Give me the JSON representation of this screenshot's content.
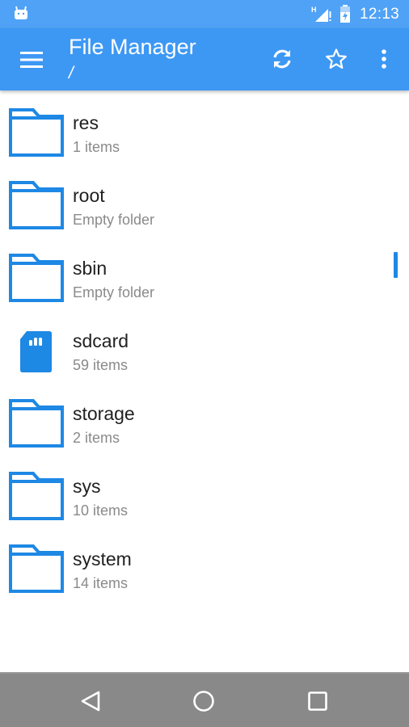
{
  "status_bar": {
    "time": "12:13",
    "network_label": "H",
    "icons": [
      "android-notification-icon",
      "signal-icon",
      "battery-charging-icon"
    ]
  },
  "app_bar": {
    "title": "File Manager",
    "path": "/",
    "icons": [
      "menu-icon",
      "refresh-icon",
      "star-icon",
      "more-vert-icon"
    ]
  },
  "files": [
    {
      "name": "res",
      "meta": "1 items",
      "icon": "folder-icon"
    },
    {
      "name": "root",
      "meta": "Empty folder",
      "icon": "folder-icon"
    },
    {
      "name": "sbin",
      "meta": "Empty folder",
      "icon": "folder-icon"
    },
    {
      "name": "sdcard",
      "meta": "59 items",
      "icon": "sdcard-icon"
    },
    {
      "name": "storage",
      "meta": "2 items",
      "icon": "folder-icon"
    },
    {
      "name": "sys",
      "meta": "10 items",
      "icon": "folder-icon"
    },
    {
      "name": "system",
      "meta": "14 items",
      "icon": "folder-icon"
    }
  ],
  "nav_bar": {
    "icons": [
      "back-icon",
      "home-icon",
      "recents-icon"
    ]
  },
  "colors": {
    "status_bar": "#4fa2f5",
    "app_bar": "#3d98f4",
    "icon_blue": "#1e88e5",
    "nav_bar": "#898989"
  }
}
